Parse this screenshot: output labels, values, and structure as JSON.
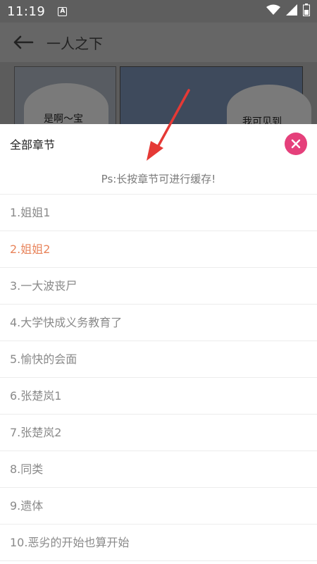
{
  "status_bar": {
    "time": "11:19",
    "notification_badge": "A"
  },
  "app_bar": {
    "title": "一人之下"
  },
  "comic": {
    "bubble_left_text": "是啊～宝",
    "bubble_right_text": "我可见到"
  },
  "sheet": {
    "title": "全部章节",
    "hint": "Ps:长按章节可进行缓存!",
    "active_index": 1,
    "chapters": [
      "1.姐姐1",
      "2.姐姐2",
      "3.一大波丧尸",
      "4.大学快成义务教育了",
      "5.愉快的会面",
      "6.张楚岚1",
      "7.张楚岚2",
      "8.同类",
      "9.遗体",
      "10.恶劣的开始也算开始"
    ]
  },
  "colors": {
    "accent": "#e5407b",
    "active_chapter": "#e8845b",
    "arrow": "#e53935"
  },
  "icons": {
    "back": "arrow-left-icon",
    "close": "close-icon",
    "wifi": "wifi-icon",
    "signal": "signal-icon",
    "battery": "battery-icon"
  }
}
